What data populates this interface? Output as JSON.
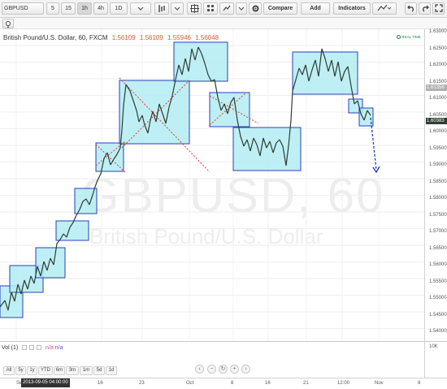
{
  "toolbar": {
    "symbol": "GBPUSD",
    "intervals": [
      "5",
      "15",
      "1h",
      "4h",
      "1D"
    ],
    "active_interval": "1h",
    "compare_label": "Compare",
    "add_label": "Add",
    "indicators_label": "Indicators"
  },
  "legend": {
    "title": "British Pound/U.S. Dollar, 60, FXCM",
    "open": "1.56109",
    "high": "1.56109",
    "low": "1.55946",
    "close": "1.56048"
  },
  "badge": "REAL TIME",
  "watermark": {
    "line1": "GBPUSD, 60",
    "line2": "British Pound/U.S. Dollar"
  },
  "price_axis": {
    "ticks": [
      "1.63000",
      "1.62500",
      "1.62000",
      "1.61500",
      "1.61000",
      "1.60500",
      "1.60000",
      "1.59500",
      "1.59000",
      "1.58500",
      "1.58000",
      "1.57500",
      "1.57000",
      "1.56500",
      "1.56000",
      "1.55500",
      "1.55000",
      "1.54500",
      "1.54000"
    ],
    "tag_current": "1.61358",
    "tag_last": "1.60383"
  },
  "volume": {
    "label": "Vol (1)",
    "value1": "n/a",
    "value2": "n/a",
    "scale_tick": "10K"
  },
  "time_axis": {
    "labels": [
      "Se",
      "16",
      "23",
      "Oct",
      "8",
      "16",
      "21",
      "12:00",
      "Nov",
      "8"
    ]
  },
  "ranges": [
    "All",
    "5y",
    "1y",
    "YTD",
    "6m",
    "3m",
    "1m",
    "5d",
    "1d"
  ],
  "date_cursor": "2013-09-05 04:00:00",
  "colors": {
    "box_fill": "#b3ecf2",
    "box_stroke": "#2b3fbd",
    "candle": "#2f3d33",
    "red_line": "#e0382e",
    "projection": "#1f34b8",
    "tag_current": "#b0b0b0",
    "tag_last": "#2f3d33"
  },
  "icons": [
    "bar-style-icon",
    "crosshair-icon",
    "dropdown-icon",
    "settings-icon",
    "drawing-tools-icon",
    "undo-icon",
    "redo-icon",
    "fullscreen-icon",
    "lightbulb-icon",
    "zoom-in-icon",
    "zoom-out-icon",
    "scroll-left-icon",
    "scroll-right-icon",
    "reset-icon"
  ]
}
